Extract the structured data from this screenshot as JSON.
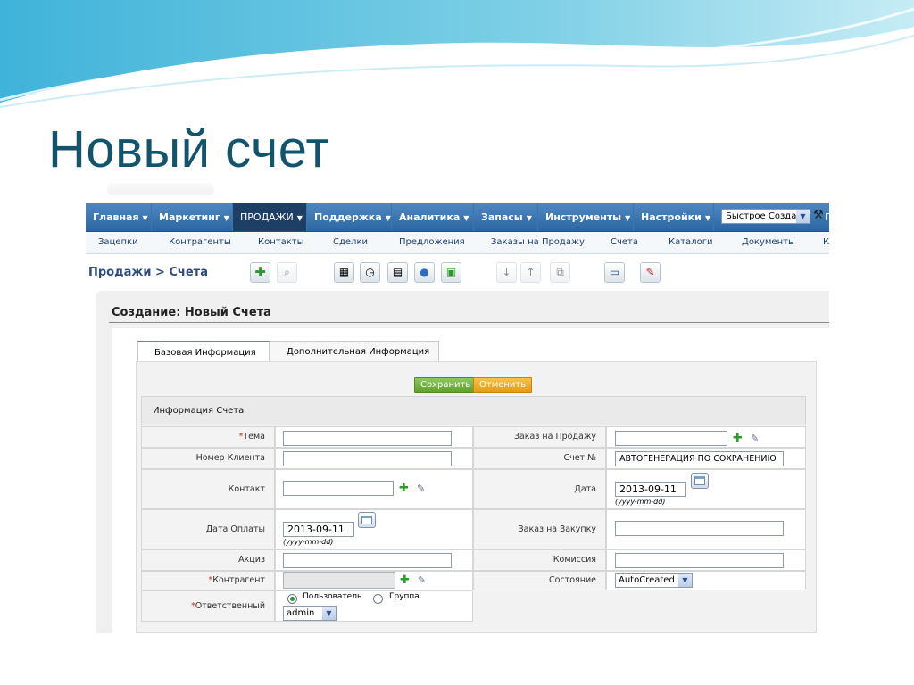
{
  "slide": {
    "title": "Новый счет"
  },
  "navbar": {
    "items": [
      {
        "label": "Главная"
      },
      {
        "label": "Маркетинг"
      },
      {
        "label": "ПРОДАЖИ"
      },
      {
        "label": "Поддержка"
      },
      {
        "label": "Аналитика"
      },
      {
        "label": "Запасы"
      },
      {
        "label": "Инструменты"
      },
      {
        "label": "Настройки"
      }
    ],
    "active_index": 2,
    "quick_create": "Быстрое Созда",
    "cut_text": "П"
  },
  "subnav": {
    "items": [
      "Зацепки",
      "Контрагенты",
      "Контакты",
      "Сделки",
      "Предложения",
      "Заказы на Продажу",
      "Счета",
      "Каталоги",
      "Документы",
      "К"
    ]
  },
  "breadcrumb": {
    "text": "Продажи > Счета"
  },
  "toolbar_icons": [
    "add-icon",
    "search-icon",
    "calendar-icon",
    "clock-icon",
    "calculator-icon",
    "chat-icon",
    "clipboard-icon",
    "import-icon",
    "export-icon",
    "find-duplicates-icon",
    "monitor-icon",
    "settings-icon"
  ],
  "form": {
    "title": "Создание: Новый Счета",
    "tabs": [
      "Базовая Информация",
      "Дополнительная Информация"
    ],
    "save_label": "Сохранить",
    "cancel_label": "Отменить",
    "section_title": "Информация Счета",
    "date_format": "(yyyy-mm-dd)",
    "fields": {
      "subject": {
        "label": "Тема",
        "required": "*",
        "value": ""
      },
      "sales_order": {
        "label": "Заказ на Продажу",
        "value": ""
      },
      "customer_no": {
        "label": "Номер Клиента",
        "value": ""
      },
      "invoice_no": {
        "label": "Счет №",
        "value": "АВТОГЕНЕРАЦИЯ ПО СОХРАНЕНИЮ"
      },
      "contact": {
        "label": "Контакт",
        "value": ""
      },
      "date": {
        "label": "Дата",
        "value": "2013-09-11"
      },
      "due_date": {
        "label": "Дата Оплаты",
        "value": "2013-09-11"
      },
      "purchase_order": {
        "label": "Заказ на Закупку",
        "value": ""
      },
      "excise": {
        "label": "Акциз",
        "value": ""
      },
      "commission": {
        "label": "Комиссия",
        "value": ""
      },
      "account": {
        "label": "Контрагент",
        "required": "*",
        "value": ""
      },
      "status": {
        "label": "Состояние",
        "value": "AutoCreated"
      },
      "assigned": {
        "label": "Ответственный",
        "required": "*",
        "option_user": "Пользователь",
        "option_group": "Группа",
        "value": "admin"
      }
    }
  }
}
